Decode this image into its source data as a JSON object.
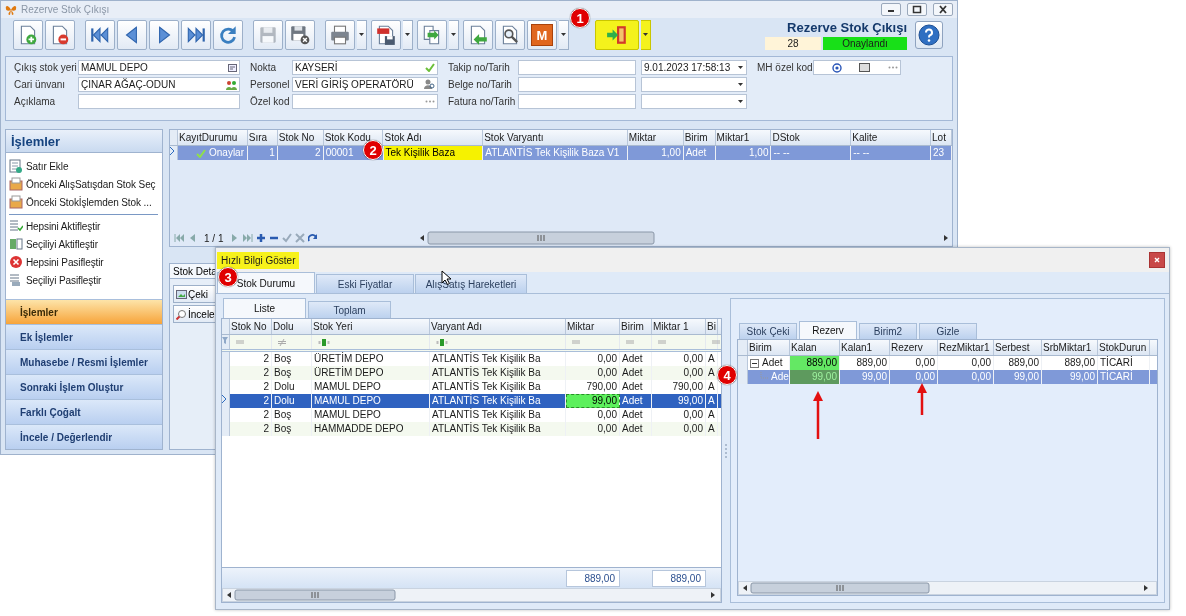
{
  "window": {
    "title": "Rezerve Stok Çıkışı"
  },
  "toolbar": [
    {
      "kind": "new"
    },
    {
      "kind": "delete"
    },
    {
      "kind": "first"
    },
    {
      "kind": "prev"
    },
    {
      "kind": "next"
    },
    {
      "kind": "last"
    },
    {
      "kind": "refresh"
    },
    {
      "kind": "save",
      "disabled": true
    },
    {
      "kind": "save_close",
      "disabled": false
    },
    {
      "kind": "print",
      "menu": true
    },
    {
      "kind": "pdf",
      "menu": true
    },
    {
      "kind": "export",
      "menu": true
    },
    {
      "kind": "import"
    },
    {
      "kind": "inspect"
    },
    {
      "kind": "module",
      "label": "M",
      "menu": true
    },
    {
      "kind": "exit",
      "menu": true,
      "highlighted": true
    }
  ],
  "document": {
    "title": "Rezerve Stok Çıkışı",
    "number": "28",
    "status": "Onaylandı"
  },
  "form": [
    [
      {
        "label": "Çıkış stok yeri",
        "value": "MAMUL DEPO",
        "kind": "lookup"
      },
      {
        "label": "Cari ünvanı",
        "value": "ÇINAR AĞAÇ-ODUN",
        "kind": "people"
      },
      {
        "label": "Açıklama",
        "kind": "text"
      }
    ],
    [
      {
        "label": "Nokta",
        "value": "KAYSERİ",
        "kind": "check"
      },
      {
        "label": "Personel",
        "value": "VERİ GİRİŞ OPERATÖRÜ",
        "kind": "user"
      },
      {
        "label": "Özel kod",
        "kind": "dots"
      }
    ],
    [
      {
        "label": "Takip no/Tarih",
        "kind": "text_date",
        "date": "9.01.2023 17:58:13"
      },
      {
        "label": "Belge no/Tarih",
        "kind": "text_date"
      },
      {
        "label": "Fatura no/Tarih",
        "kind": "text_date"
      }
    ],
    [
      {
        "label": "MH özel kod",
        "kind": "code"
      }
    ]
  ],
  "actions_panel": {
    "title": "İşlemler",
    "groups": [
      [
        {
          "label": "Satır Ekle",
          "kind": "add"
        },
        {
          "label": "Önceki AlışSatışdan Stok Seç",
          "kind": "pick"
        },
        {
          "label": "Önceki Stokİşlemden Stok ...",
          "kind": "pick"
        }
      ],
      [
        {
          "label": "Hepsini Aktifleştir",
          "kind": "activate_all"
        },
        {
          "label": "Seçiliyi Aktifleştir",
          "kind": "activate"
        },
        {
          "label": "Hepsini Pasifleştir",
          "kind": "deactivate_all"
        },
        {
          "label": "Seçiliyi Pasifleştir",
          "kind": "deactivate"
        }
      ]
    ]
  },
  "nav": [
    {
      "label": "İşlemler",
      "selected": true
    },
    {
      "label": "Ek İşlemler",
      "selected": false
    },
    {
      "label": "Muhasebe / Resmi İşlemler",
      "selected": false
    },
    {
      "label": "Sonraki İşlem Oluştur",
      "selected": false
    },
    {
      "label": "Farklı Çoğalt",
      "selected": false
    },
    {
      "label": "İncele / Değerlendir",
      "selected": false
    }
  ],
  "lines_grid": {
    "columns": [
      "KayıtDurumu",
      "Sıra",
      "Stok No",
      "Stok Kodu",
      "Stok Adı",
      "Stok Varyantı",
      "Miktar",
      "Birim",
      "Miktar1",
      "DStok",
      "Kalite",
      "Lot"
    ],
    "rows": [
      {
        "selected": true,
        "cells": [
          "Onaylar",
          "1",
          "2",
          "00001",
          {
            "text": "Tek Kişilik Baza",
            "highlighted": true
          },
          "ATLANTİS Tek Kişilik Baza V1",
          "1,00",
          "Adet",
          "1,00",
          "-- --",
          "-- --",
          "23"
        ]
      }
    ],
    "pager": "1 / 1"
  },
  "detail_tabs": [
    {
      "label": "Stok Deta",
      "selected": true
    }
  ],
  "detail_buttons": [
    "Çeki",
    "İncele"
  ],
  "quick_info": {
    "title": "Hızlı Bilgi Göster",
    "highlighted": true,
    "tabs": [
      {
        "label": "Stok Durumu",
        "selected": true
      },
      {
        "label": "Eski Fiyatlar",
        "selected": false
      },
      {
        "label": "AlışSatış Hareketleri",
        "selected": false
      }
    ],
    "subtabs": [
      {
        "label": "Liste",
        "selected": true
      },
      {
        "label": "Toplam",
        "selected": false
      }
    ],
    "stock_grid": {
      "columns": [
        "Stok No",
        "Dolu",
        "Stok Yeri",
        "Varyant Adı",
        "Miktar",
        "Birim",
        "Miktar 1",
        "Bi"
      ],
      "rows": [
        {
          "selected": false,
          "cells": [
            "2",
            "Boş",
            "ÜRETİM DEPO",
            "ATLANTİS Tek Kişilik Ba",
            "0,00",
            "Adet",
            "0,00",
            "A"
          ]
        },
        {
          "selected": false,
          "cells": [
            "2",
            "Boş",
            "ÜRETİM DEPO",
            "ATLANTİS Tek Kişilik Ba",
            "0,00",
            "Adet",
            "0,00",
            "A"
          ]
        },
        {
          "selected": false,
          "cells": [
            "2",
            "Dolu",
            "MAMUL DEPO",
            "ATLANTİS Tek Kişilik Ba",
            "790,00",
            "Adet",
            "790,00",
            "A"
          ]
        },
        {
          "selected": true,
          "cells": [
            "2",
            "Dolu",
            "MAMUL DEPO",
            "ATLANTİS Tek Kişilik Ba",
            {
              "text": "99,00",
              "highlighted": true
            },
            "Adet",
            "99,00",
            "A"
          ]
        },
        {
          "selected": false,
          "cells": [
            "2",
            "Boş",
            "MAMUL DEPO",
            "ATLANTİS Tek Kişilik Ba",
            "0,00",
            "Adet",
            "0,00",
            "A"
          ]
        },
        {
          "selected": false,
          "cells": [
            "2",
            "Boş",
            "HAMMADDE DEPO",
            "ATLANTİS Tek Kişilik Ba",
            "0,00",
            "Adet",
            "0,00",
            "A"
          ]
        }
      ],
      "totals": [
        "889,00",
        "889,00"
      ]
    },
    "detail_tabs": [
      {
        "label": "Stok Çeki",
        "selected": false
      },
      {
        "label": "Rezerv",
        "selected": true
      },
      {
        "label": "Birim2",
        "selected": false
      },
      {
        "label": "Gizle",
        "selected": false
      }
    ],
    "unit_grid": {
      "columns": [
        "Birim",
        "Kalan",
        "Kalan1",
        "Rezerv",
        "RezMiktar1",
        "Serbest",
        "SrbMiktar1",
        "StokDurun"
      ],
      "rows": [
        {
          "selected": false,
          "expanded": true,
          "cells": [
            "Adet",
            {
              "text": "889,00",
              "highlighted": true
            },
            "889,00",
            "0,00",
            "0,00",
            "889,00",
            "889,00",
            "TİCARİ"
          ],
          "children": [
            {
              "selected": true,
              "cells": [
                "Ade",
                {
                  "text": "99,00",
                  "highlighted": true
                },
                "99,00",
                "0,00",
                "0,00",
                "99,00",
                "99,00",
                "TİCARİ"
              ]
            }
          ]
        }
      ]
    }
  },
  "annotations": [
    {
      "label": "1"
    },
    {
      "label": "2"
    },
    {
      "label": "3"
    },
    {
      "label": "4"
    }
  ]
}
